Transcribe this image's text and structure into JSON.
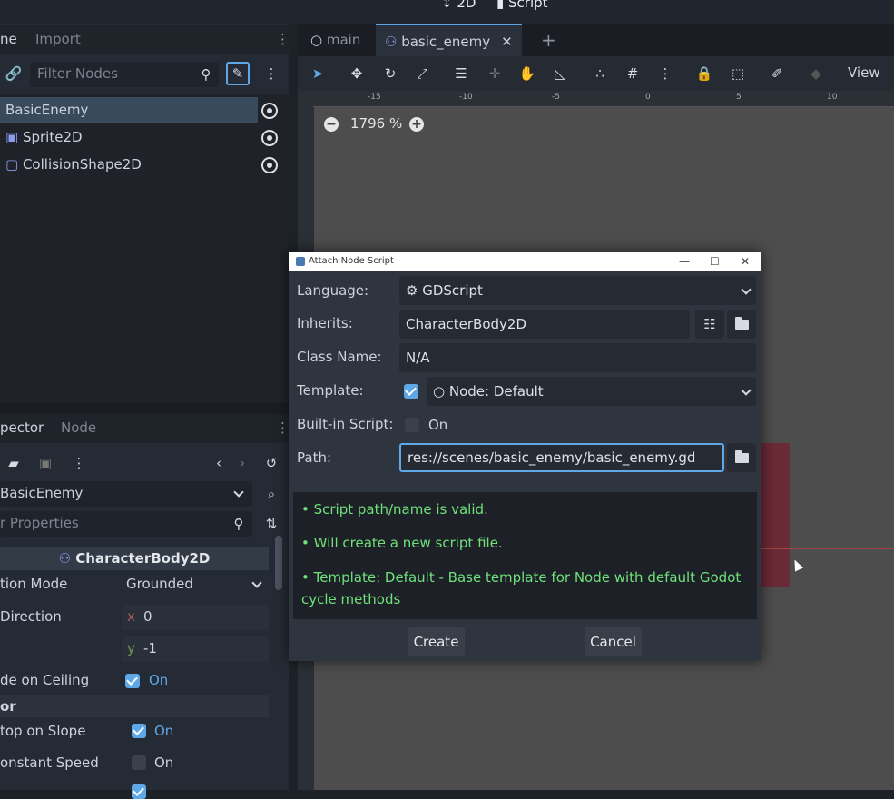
{
  "top": {
    "mode_2d": "2D",
    "mode_script": "Script"
  },
  "scene_dock": {
    "tabs": [
      "ne",
      "Import"
    ],
    "filter_placeholder": "Filter Nodes",
    "nodes": [
      {
        "label": "BasicEnemy",
        "selected": true
      },
      {
        "label": "Sprite2D",
        "selected": false
      },
      {
        "label": "CollisionShape2D",
        "selected": false
      }
    ]
  },
  "inspector": {
    "tabs": [
      "pector",
      "Node"
    ],
    "object": "BasicEnemy",
    "filter_placeholder": "r Properties",
    "section": "CharacterBody2D",
    "props": [
      {
        "label": "tion Mode",
        "value": "Grounded"
      },
      {
        "label": "Direction",
        "x": "0",
        "y": "-1"
      },
      {
        "label": "de on Ceiling",
        "value": "On",
        "checked": true
      },
      {
        "label": "or"
      },
      {
        "label": "top on Slope",
        "value": "On",
        "checked": true
      },
      {
        "label": "onstant Speed",
        "value": "On",
        "checked": false
      }
    ],
    "x_letter": "x",
    "y_letter": "y"
  },
  "editor": {
    "tabs": [
      {
        "label": "main",
        "active": false
      },
      {
        "label": "basic_enemy",
        "active": true
      }
    ],
    "view_label": "View",
    "zoom": "1796 %",
    "ruler_ticks": [
      "-15",
      "-10",
      "-5",
      "0",
      "5",
      "10"
    ]
  },
  "dialog": {
    "title": "Attach Node Script",
    "language_label": "Language:",
    "language_value": "GDScript",
    "inherits_label": "Inherits:",
    "inherits_value": "CharacterBody2D",
    "classname_label": "Class Name:",
    "classname_value": "N/A",
    "template_label": "Template:",
    "template_value": "Node: Default",
    "builtin_label": "Built-in Script:",
    "builtin_value": "On",
    "path_label": "Path:",
    "path_value": "res://scenes/basic_enemy/basic_enemy.gd",
    "messages": [
      "Script path/name is valid.",
      "Will create a new script file.",
      "Template: Default - Base template for Node with default Godot cycle methods"
    ],
    "create_label": "Create",
    "cancel_label": "Cancel",
    "colors": {
      "valid_green": "#6fe07a",
      "accent": "#5fa8e8"
    }
  }
}
